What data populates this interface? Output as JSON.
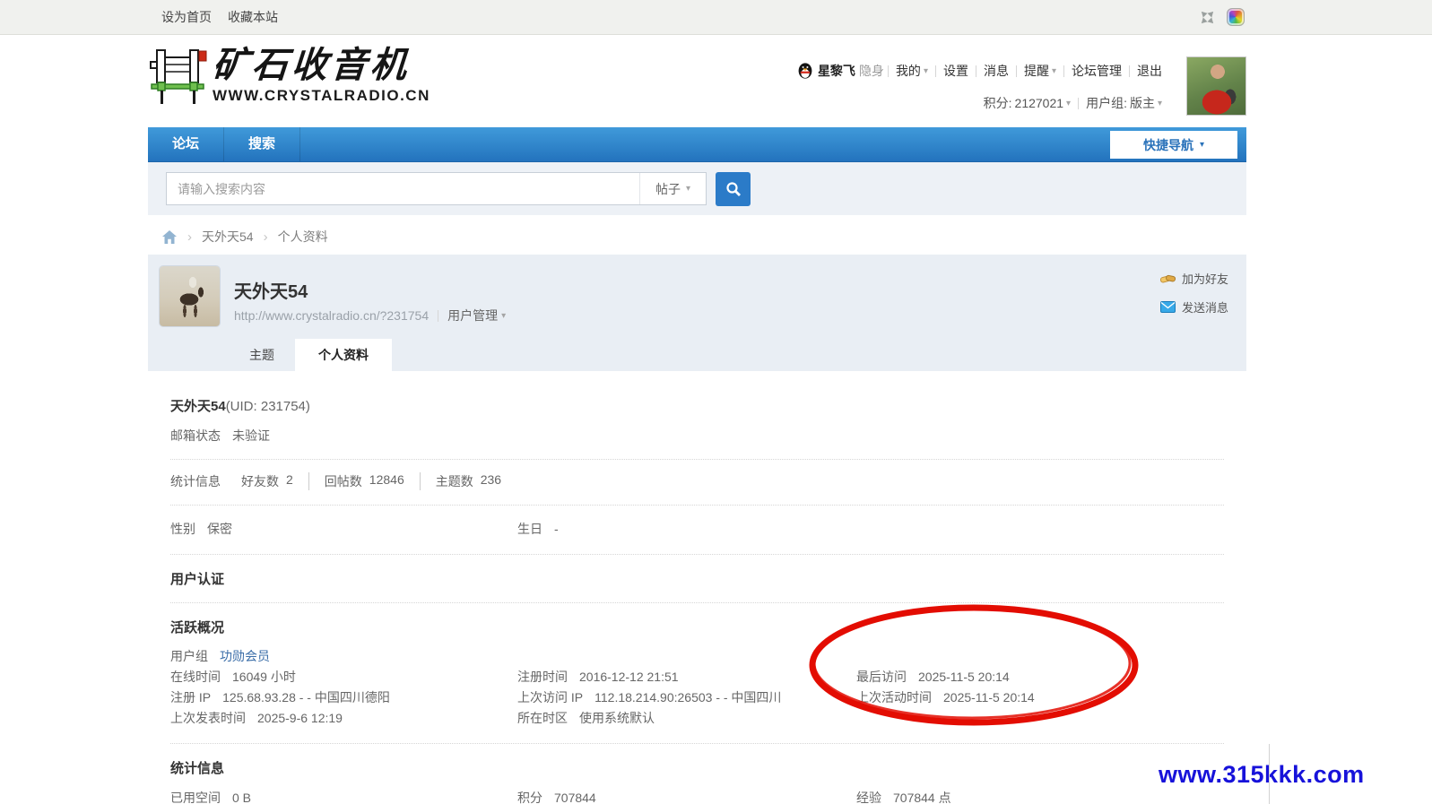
{
  "topbar": {
    "set_home": "设为首页",
    "bookmark": "收藏本站"
  },
  "header": {
    "site_name": "矿石收音机",
    "site_url": "WWW.CRYSTALRADIO.CN",
    "user_name": "星黎飞",
    "user_status": "隐身",
    "menu": {
      "my": "我的",
      "settings": "设置",
      "messages": "消息",
      "notices": "提醒",
      "forum_admin": "论坛管理",
      "logout": "退出"
    },
    "credits_label": "积分: ",
    "credits_value": "2127021",
    "group_label": "用户组: ",
    "group_value": "版主"
  },
  "nav": {
    "forum": "论坛",
    "search": "搜索",
    "quick_nav": "快捷导航"
  },
  "search": {
    "placeholder": "请输入搜索内容",
    "scope": "帖子"
  },
  "breadcrumb": {
    "user": "天外天54",
    "page": "个人资料"
  },
  "card": {
    "username": "天外天54",
    "profile_url": "http://www.crystalradio.cn/?231754",
    "user_manage": "用户管理",
    "add_friend": "加为好友",
    "send_message": "发送消息",
    "tab_threads": "主题",
    "tab_profile": "个人资料"
  },
  "profile": {
    "name": "天外天54",
    "uid": "(UID: 231754)",
    "email_label": "邮箱状态",
    "email_value": "未验证",
    "stats_label": "统计信息",
    "stats": [
      {
        "label": "好友数",
        "value": "2"
      },
      {
        "label": "回帖数",
        "value": "12846"
      },
      {
        "label": "主题数",
        "value": "236"
      }
    ],
    "gender_label": "性别",
    "gender_value": "保密",
    "birthday_label": "生日",
    "birthday_value": "-",
    "auth_title": "用户认证",
    "activity_title": "活跃概况",
    "activity": {
      "group_label": "用户组",
      "group_value": "功勋会员",
      "rows": [
        [
          {
            "label": "在线时间",
            "value": "16049 小时"
          },
          {
            "label": "注册时间",
            "value": "2016-12-12 21:51"
          },
          {
            "label": "最后访问",
            "value": "2025-11-5 20:14"
          }
        ],
        [
          {
            "label": "注册 IP",
            "value": "125.68.93.28 - - 中国四川德阳"
          },
          {
            "label": "上次访问 IP",
            "value": "112.18.214.90:26503 - - 中国四川"
          },
          {
            "label": "上次活动时间",
            "value": "2025-11-5 20:14"
          }
        ],
        [
          {
            "label": "上次发表时间",
            "value": "2025-9-6 12:19"
          },
          {
            "label": "所在时区",
            "value": "使用系统默认"
          }
        ]
      ]
    },
    "statistics_title": "统计信息",
    "statistics_row": [
      {
        "label": "已用空间",
        "value": "0 B"
      },
      {
        "label": "积分",
        "value": "707844"
      },
      {
        "label": "经验",
        "value": "707844 点"
      }
    ]
  },
  "watermark": "www.315kkk.com",
  "icons": {
    "dropdown": "▾",
    "separator": "›"
  }
}
